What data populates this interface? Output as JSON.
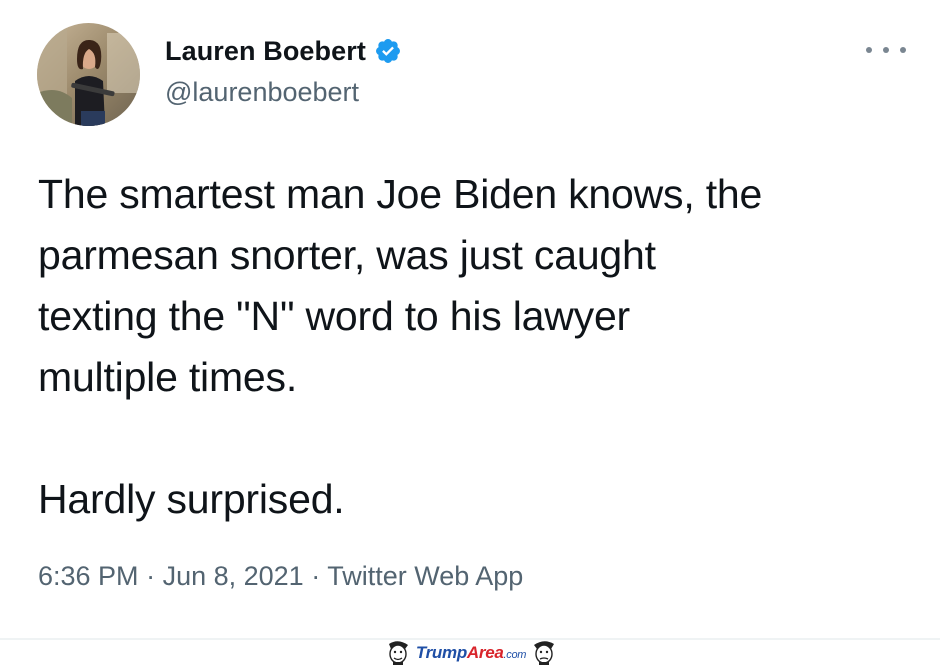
{
  "tweet": {
    "author": {
      "display_name": "Lauren Boebert",
      "handle": "@laurenboebert",
      "verified": true,
      "avatar_icon": "profile-photo"
    },
    "text": "The smartest man Joe Biden knows, the\nparmesan snorter, was just caught\ntexting the \"N\" word to his lawyer\nmultiple times.\n\nHardly surprised.",
    "time": "6:36 PM",
    "date": "Jun 8, 2021",
    "source": "Twitter Web App",
    "separator": "·",
    "more_icon": "more-options-icon"
  },
  "watermark": {
    "brand_part1": "Trump",
    "brand_part2": "Area",
    "brand_suffix": ".com"
  },
  "colors": {
    "text_primary": "#0f1419",
    "text_secondary": "#536471",
    "verified_blue": "#1d9bf0",
    "watermark_blue": "#1f4fa6",
    "watermark_red": "#d8242b"
  }
}
